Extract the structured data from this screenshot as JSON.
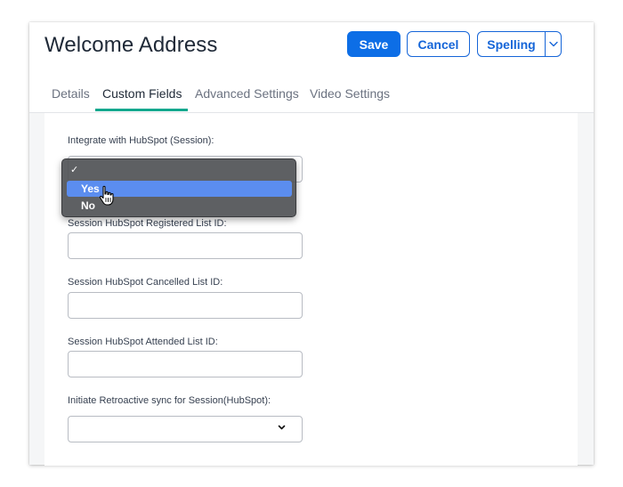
{
  "header": {
    "title": "Welcome Address",
    "save_label": "Save",
    "cancel_label": "Cancel",
    "spelling_label": "Spelling"
  },
  "tabs": [
    {
      "label": "Details"
    },
    {
      "label": "Custom Fields"
    },
    {
      "label": "Advanced Settings"
    },
    {
      "label": "Video Settings"
    }
  ],
  "active_tab": "Custom Fields",
  "fields": {
    "integrate_label": "Integrate with HubSpot (Session):",
    "registered_label": "Session HubSpot Registered List ID:",
    "cancelled_label": "Session HubSpot Cancelled List ID:",
    "attended_label": "Session HubSpot Attended List ID:",
    "retroactive_label": "Initiate Retroactive sync for Session(HubSpot):"
  },
  "dropdown": {
    "check_mark": "✓",
    "options": [
      {
        "label": "Yes"
      },
      {
        "label": "No"
      }
    ],
    "highlighted": "Yes"
  },
  "colors": {
    "primary": "#0d6ee6",
    "tab_accent": "#14a88e",
    "dropdown_highlight": "#5b8def"
  }
}
